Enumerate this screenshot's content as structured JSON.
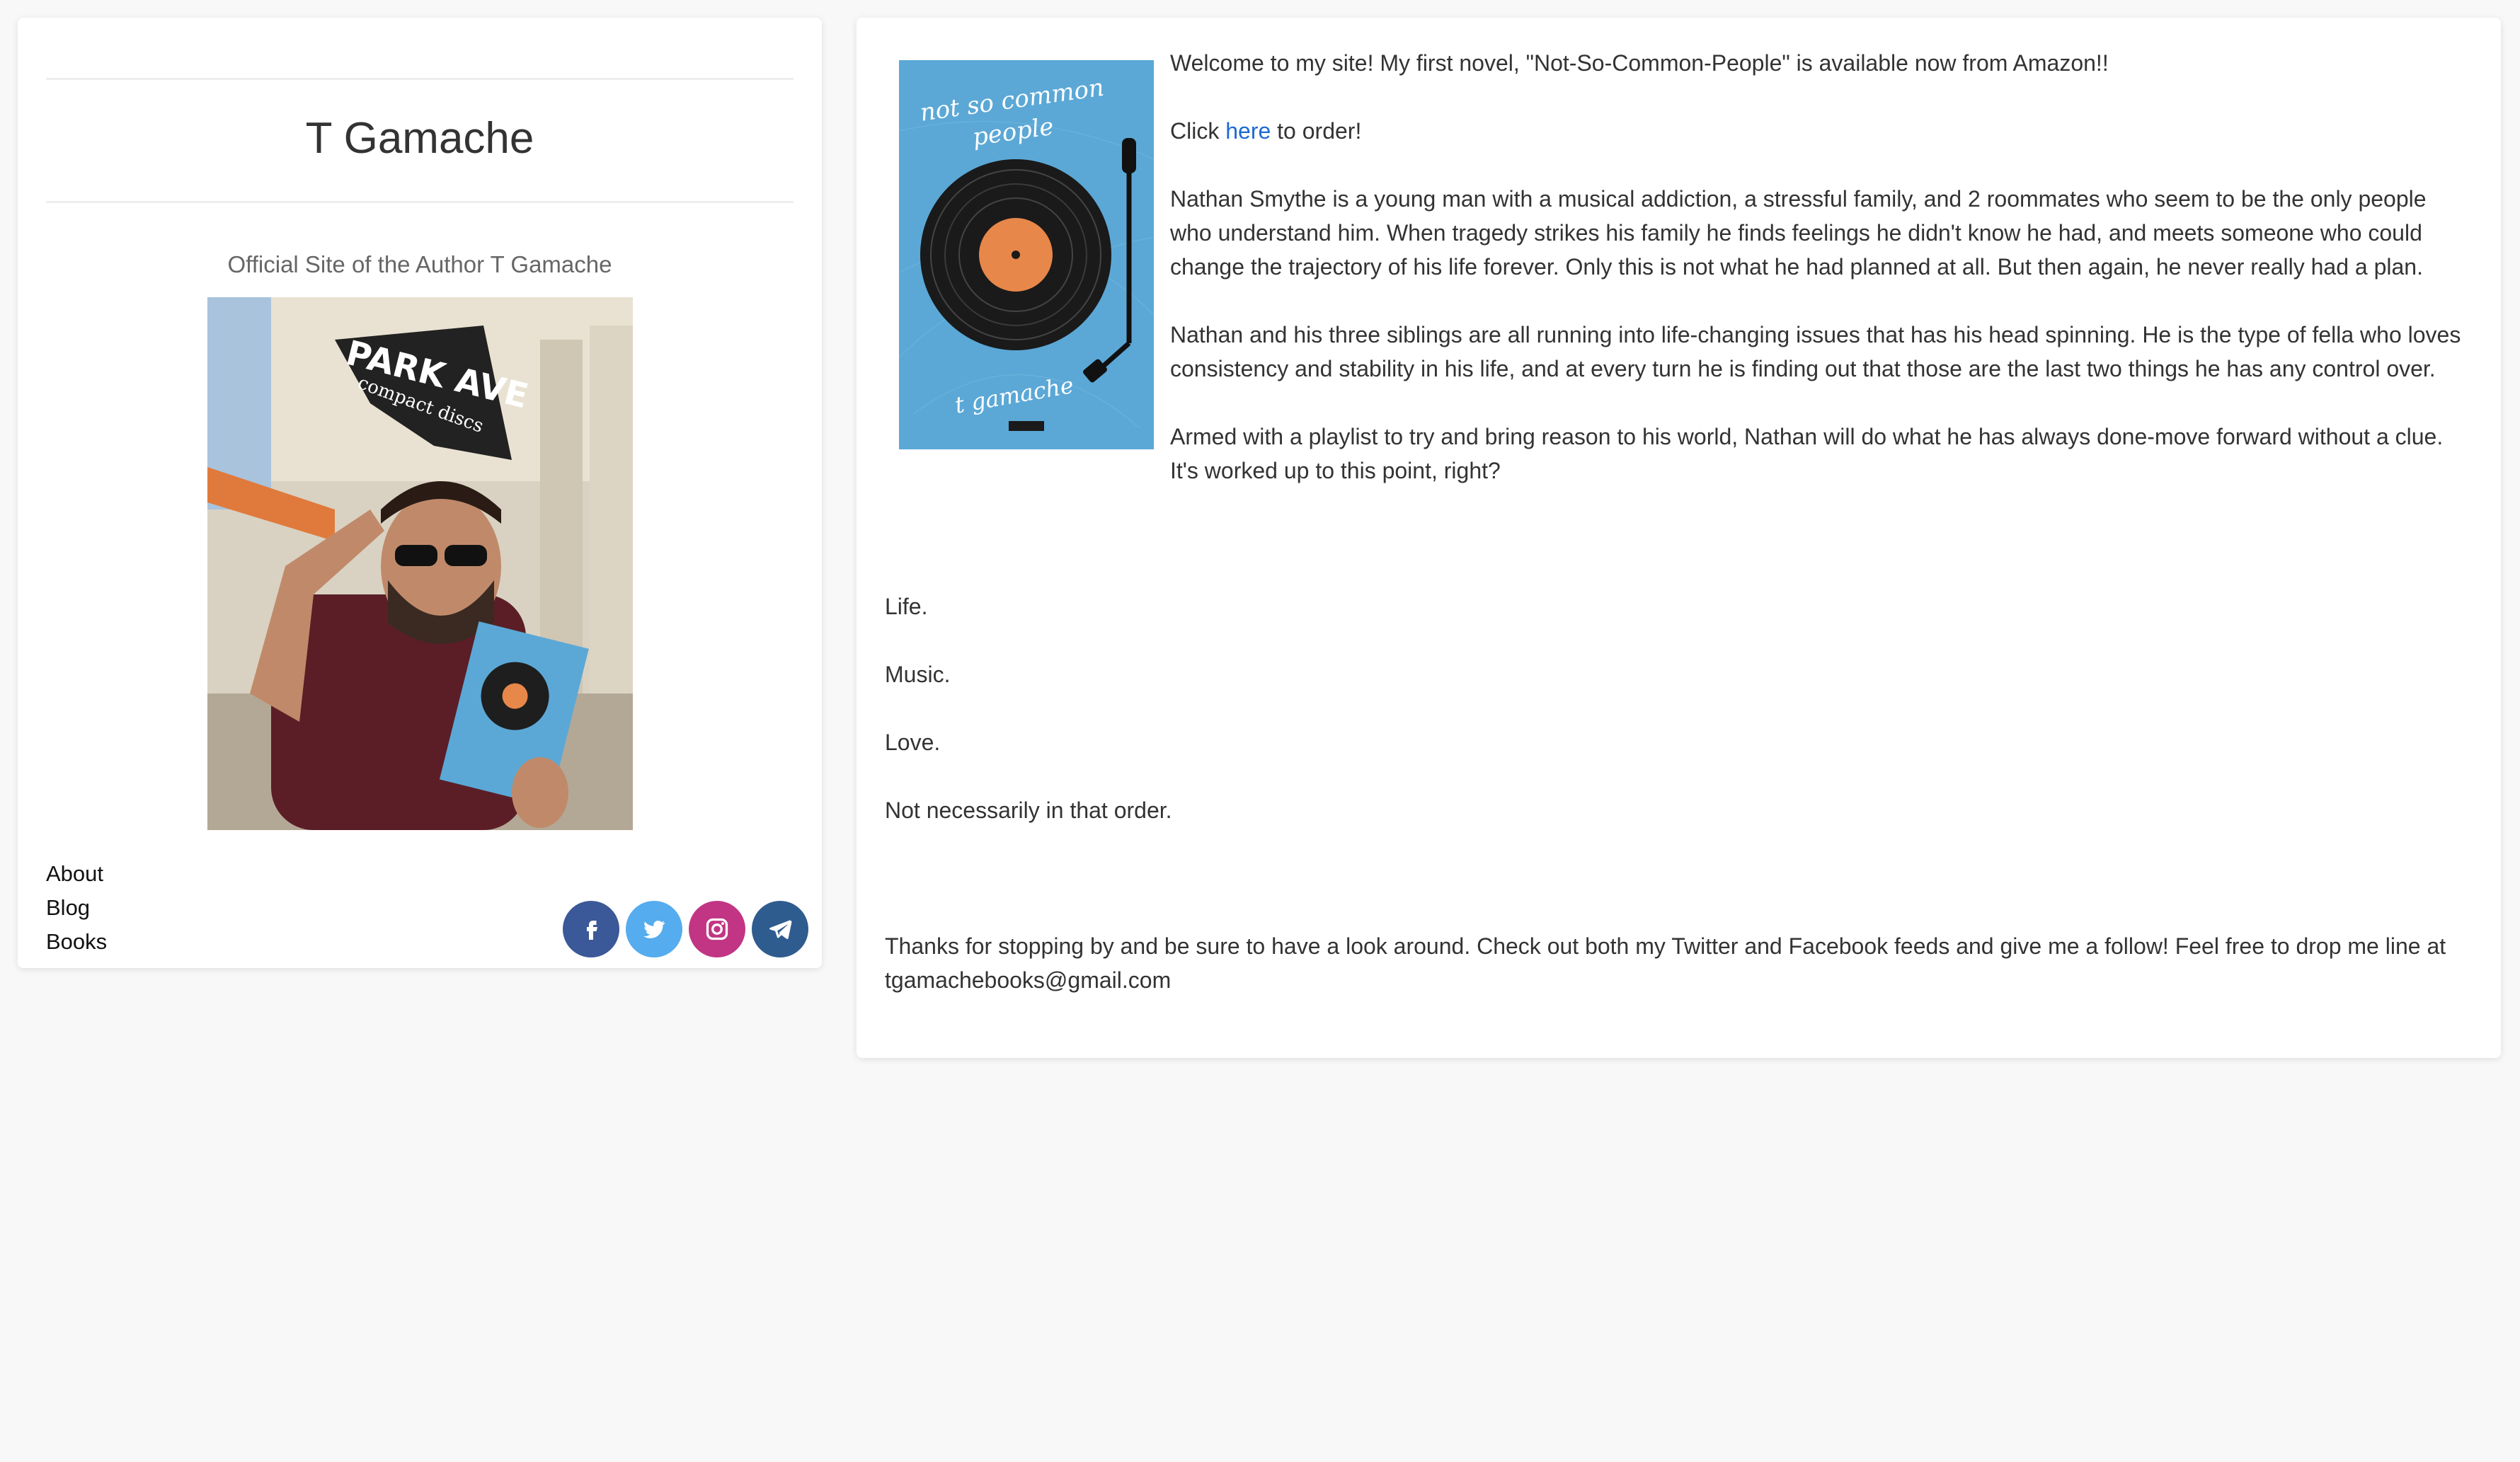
{
  "site": {
    "title": "T Gamache",
    "tagline": "Official Site of the Author T Gamache"
  },
  "author_photo": {
    "sign_line1": "PARK AVE",
    "sign_line2": "compact discs"
  },
  "nav": [
    {
      "label": "About"
    },
    {
      "label": "Blog"
    },
    {
      "label": "Books"
    }
  ],
  "social": [
    {
      "name": "facebook",
      "icon": "facebook-icon",
      "color": "#3b5998"
    },
    {
      "name": "twitter",
      "icon": "twitter-icon",
      "color": "#55acee"
    },
    {
      "name": "instagram",
      "icon": "instagram-icon",
      "color": "#c13584"
    },
    {
      "name": "telegram",
      "icon": "telegram-icon",
      "color": "#2f5c8f"
    }
  ],
  "book_cover": {
    "title_line1": "not so common",
    "title_line2": "people",
    "author": "t gamache",
    "color": "#5ba8d6",
    "label_color": "#e8874a"
  },
  "content": {
    "welcome": "Welcome to my site! My first novel, \"Not-So-Common-People\" is available now from Amazon!!",
    "order_prefix": "Click ",
    "order_link": "here",
    "order_suffix": " to order!",
    "para1": "Nathan Smythe is a young man with a musical addiction, a stressful family, and 2 roommates who seem to be the only people who understand him. When tragedy strikes his family he finds feelings he didn't know he had, and meets someone who could change the trajectory of his life forever. Only this is not what he had planned at all. But then again, he never really had a plan.",
    "para2": "Nathan and his three siblings are all running into life-changing issues that has his head spinning. He is the type of fella who loves consistency and stability in his life, and at every turn he is finding out that those are the last two things he has any control over.",
    "para3": "Armed with a playlist to try and bring reason to his world, Nathan will do what he has always done-move forward without a clue. It's worked up to this point, right?",
    "life": "Life.",
    "music": "Music.",
    "love": "Love.",
    "order_note": "Not necessarily in that order.",
    "thanks": "Thanks for stopping by and be sure to have a look around. Check out both my Twitter and Facebook feeds and give me a follow! Feel free to drop me line at tgamachebooks@gmail.com"
  },
  "colors": {
    "link": "#1d6ad2",
    "background": "#f8f8f8"
  }
}
